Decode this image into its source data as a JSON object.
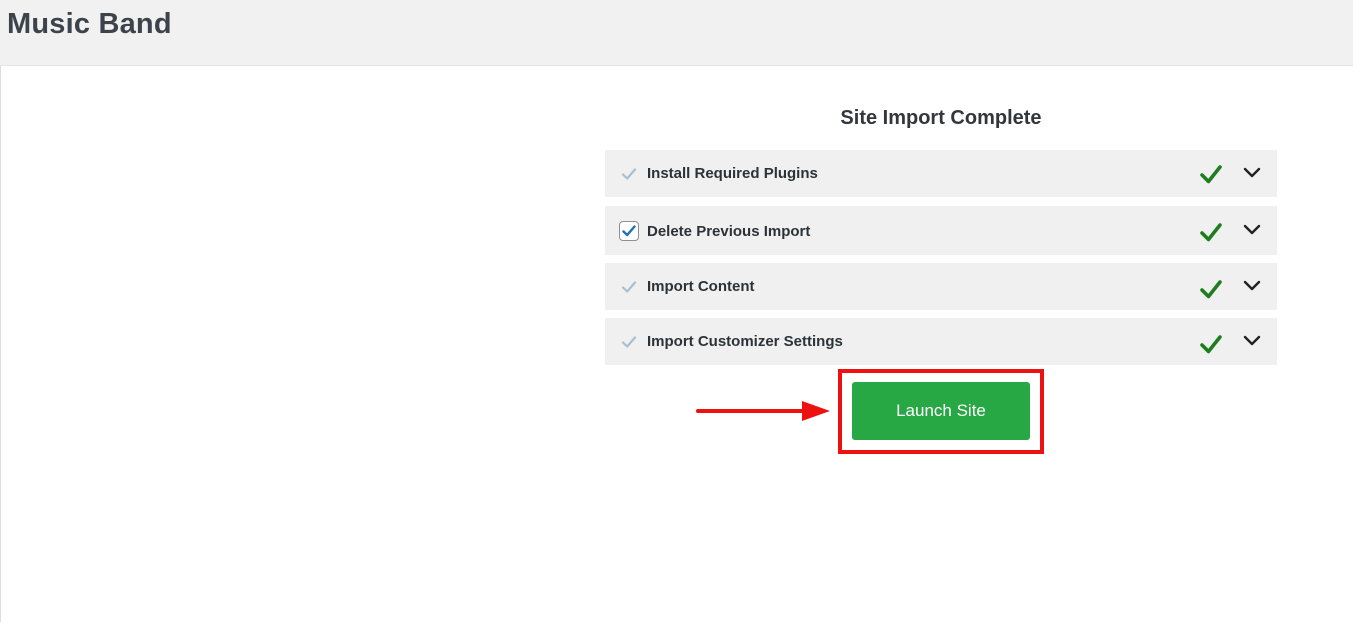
{
  "header": {
    "site_name": "Music Band"
  },
  "import_panel": {
    "title": "Site Import Complete",
    "steps": [
      {
        "label": "Install Required Plugins",
        "checkbox_style": "plain",
        "status_icon": "check-icon",
        "expand_icon": "chevron-down-icon"
      },
      {
        "label": "Delete Previous Import",
        "checkbox_style": "boxed",
        "status_icon": "check-icon",
        "expand_icon": "chevron-down-icon"
      },
      {
        "label": "Import Content",
        "checkbox_style": "plain",
        "status_icon": "check-icon",
        "expand_icon": "chevron-down-icon"
      },
      {
        "label": "Import Customizer Settings",
        "checkbox_style": "plain",
        "status_icon": "check-icon",
        "expand_icon": "chevron-down-icon"
      }
    ],
    "launch_button": {
      "label": "Launch Site"
    }
  },
  "annotation": {
    "arrow_icon": "arrow-right-icon",
    "highlight_color": "#ee1111"
  },
  "colors": {
    "success": "#1e7d1e",
    "button_bg": "#28a745",
    "topbar_bg": "#f1f1f1",
    "row_bg": "#f0f0f0"
  }
}
